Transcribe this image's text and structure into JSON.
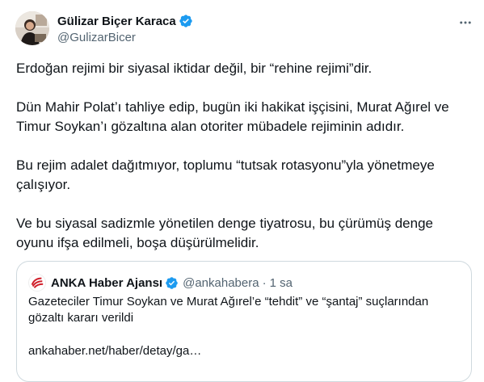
{
  "author": {
    "display_name": "Gülizar Biçer Karaca",
    "handle": "@GulizarBicer",
    "verified": true,
    "verified_color": "#1d9bf0"
  },
  "tweet": {
    "paragraphs": [
      "Erdoğan rejimi bir siyasal iktidar değil, bir “rehine rejimi”dir.",
      "Dün Mahir Polat’ı tahliye edip, bugün iki hakikat işçisini, Murat Ağırel ve Timur Soykan’ı gözaltına alan otoriter mübadele rejiminin adıdır.",
      "Bu rejim adalet dağıtmıyor, toplumu “tutsak rotasyonu”yla yönetmeye çalışıyor.",
      "Ve bu siyasal sadizmle yönetilen denge tiyatrosu, bu çürümüş denge oyunu ifşa edilmeli, boşa düşürülmelidir."
    ]
  },
  "quoted_tweet": {
    "display_name": "ANKA Haber Ajansı",
    "handle": "@ankahabera",
    "separator": "·",
    "time": "1 sa",
    "text": "Gazeteciler Timur Soykan ve Murat Ağırel’e “tehdit” ve “şantaj” suçlarından gözaltı kararı verildi",
    "link": "ankahaber.net/haber/detay/ga…",
    "logo_color": "#d0202b"
  },
  "icons": {
    "more": "more-horizontal-icon",
    "verified": "verified-badge-icon"
  }
}
